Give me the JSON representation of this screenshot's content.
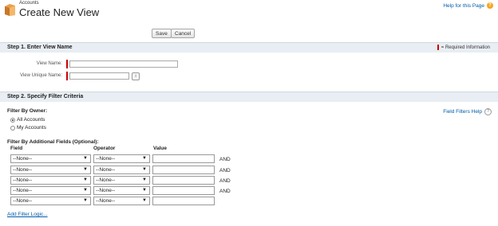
{
  "header": {
    "breadcrumb": "Accounts",
    "title": "Create New View",
    "help_link": "Help for this Page",
    "help_icon_glyph": "?"
  },
  "buttons": {
    "save": "Save",
    "cancel": "Cancel"
  },
  "step1": {
    "title": "Step 1. Enter View Name",
    "required_legend": "= Required Information",
    "view_name_label": "View Name:",
    "view_name_value": "",
    "view_unique_name_label": "View Unique Name:",
    "view_unique_name_value": "",
    "info_glyph": "i"
  },
  "step2": {
    "title": "Step 2. Specify Filter Criteria",
    "filter_by_owner_label": "Filter By Owner:",
    "owner_options": [
      {
        "label": "All Accounts",
        "selected": true
      },
      {
        "label": "My Accounts",
        "selected": false
      }
    ],
    "field_filters_help": "Field Filters Help",
    "help_glyph": "?",
    "additional_fields_label": "Filter By Additional Fields (Optional):",
    "columns": {
      "field": "Field",
      "operator": "Operator",
      "value": "Value"
    },
    "rows": [
      {
        "field": "--None--",
        "operator": "--None--",
        "value": "",
        "connector": "AND"
      },
      {
        "field": "--None--",
        "operator": "--None--",
        "value": "",
        "connector": "AND"
      },
      {
        "field": "--None--",
        "operator": "--None--",
        "value": "",
        "connector": "AND"
      },
      {
        "field": "--None--",
        "operator": "--None--",
        "value": "",
        "connector": "AND"
      },
      {
        "field": "--None--",
        "operator": "--None--",
        "value": "",
        "connector": ""
      }
    ],
    "add_filter_logic": "Add Filter Logic..."
  },
  "colors": {
    "link": "#015ba7",
    "required": "#cc0000",
    "section_bg": "#e8eef3"
  }
}
